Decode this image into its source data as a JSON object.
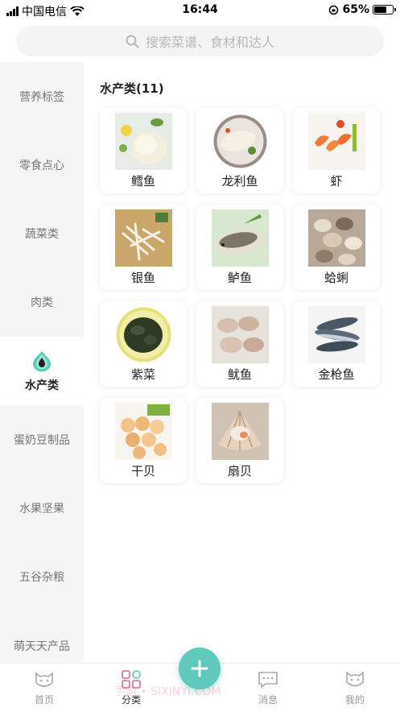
{
  "status": {
    "carrier": "中国电信",
    "time": "16:44",
    "battery": "65%"
  },
  "search": {
    "placeholder": "搜索菜谱、食材和达人"
  },
  "sidebar": {
    "items": [
      {
        "label": "营养标签"
      },
      {
        "label": "零食点心"
      },
      {
        "label": "蔬菜类"
      },
      {
        "label": "肉类"
      },
      {
        "label": "水产类",
        "active": true
      },
      {
        "label": "蛋奶豆制品"
      },
      {
        "label": "水果坚果"
      },
      {
        "label": "五谷杂粮"
      },
      {
        "label": "萌天天产品"
      }
    ]
  },
  "main": {
    "section_title": "水产类(11)",
    "items": [
      {
        "label": "鳕鱼",
        "icon": "cod-photo"
      },
      {
        "label": "龙利鱼",
        "icon": "sole-fish-photo"
      },
      {
        "label": "虾",
        "icon": "shrimp-photo"
      },
      {
        "label": "银鱼",
        "icon": "whitebait-photo"
      },
      {
        "label": "鲈鱼",
        "icon": "perch-photo"
      },
      {
        "label": "蛤蜊",
        "icon": "clam-photo"
      },
      {
        "label": "紫菜",
        "icon": "seaweed-photo"
      },
      {
        "label": "鱿鱼",
        "icon": "squid-photo"
      },
      {
        "label": "金枪鱼",
        "icon": "tuna-photo"
      },
      {
        "label": "干贝",
        "icon": "dried-scallop-photo"
      },
      {
        "label": "扇贝",
        "icon": "scallop-photo"
      }
    ]
  },
  "tabbar": {
    "tabs": [
      {
        "label": "首页",
        "icon": "cat-face-icon"
      },
      {
        "label": "分类",
        "icon": "category-grid-icon",
        "active": true
      },
      {
        "label": "消息",
        "icon": "message-icon"
      },
      {
        "label": "我的",
        "icon": "profile-cat-icon"
      }
    ]
  },
  "watermark": "手游 • SIXINYI.COM",
  "colors": {
    "accent": "#5fc9bc",
    "sidebar_bg": "#f5f5f5"
  }
}
